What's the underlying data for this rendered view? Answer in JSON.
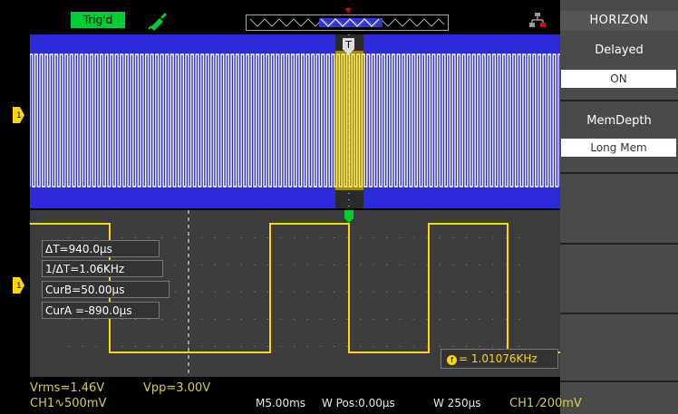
{
  "top": {
    "trig_status": "Trig'd"
  },
  "menu": {
    "title": "HORIZON",
    "item1_label": "Delayed",
    "item1_value": "ON",
    "item2_label": "MemDepth",
    "item2_value": "Long Mem"
  },
  "readouts": {
    "delta_t": "ΔT=940.0µs",
    "inv_delta_t": "1/ΔT=1.06KHz",
    "cur_b": "CurB=50.00µs",
    "cur_a": "CurA =-890.0µs",
    "freq": "= 1.01076KHz"
  },
  "status": {
    "vrms": "Vrms=1.46V",
    "vpp": "Vpp=3.00V",
    "ch1_scale": "CH1∿500mV",
    "main_time": "M5.00ms",
    "w_pos": "W Pos:0.00µs",
    "w_time": "W 250µs",
    "trigger": "CH1 ⁄200mV"
  },
  "colors": {
    "trace": "#ffd700",
    "upper_bg": "#2d2bd9",
    "lower_bg": "#3c3c3c",
    "trig_badge": "#00cc33",
    "menu_bg": "#4a4a4a"
  },
  "icons": {
    "probe": "probe-icon",
    "network": "network-icon",
    "trigger_marker": "trigger-marker-icon",
    "ch1_marker": "ch1-level-marker-icon"
  }
}
